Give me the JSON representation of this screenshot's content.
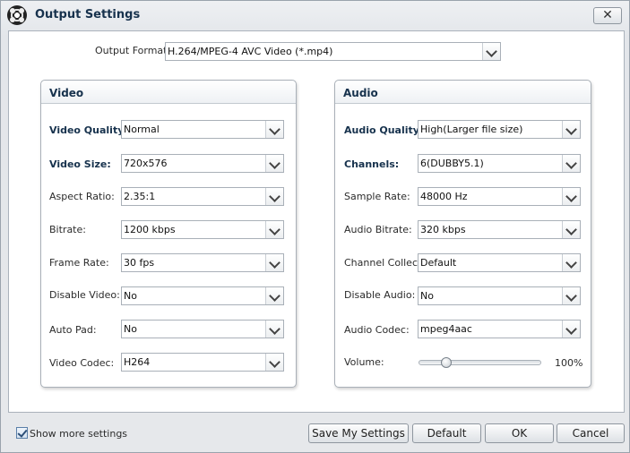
{
  "window": {
    "title": "Output Settings",
    "close_glyph": "✕"
  },
  "output": {
    "label": "Output Format:",
    "value": "H.264/MPEG-4 AVC Video (*.mp4)"
  },
  "video": {
    "header": "Video",
    "rows": [
      {
        "label": "Video Quality:",
        "value": "Normal",
        "bold": true
      },
      {
        "label": "Video Size:",
        "value": "720x576",
        "bold": true
      },
      {
        "label": "Aspect Ratio:",
        "value": "2.35:1",
        "bold": false
      },
      {
        "label": "Bitrate:",
        "value": "1200 kbps",
        "bold": false
      },
      {
        "label": "Frame Rate:",
        "value": "30 fps",
        "bold": false
      },
      {
        "label": "Disable Video:",
        "value": "No",
        "bold": false
      },
      {
        "label": "Auto Pad:",
        "value": "No",
        "bold": false
      },
      {
        "label": "Video Codec:",
        "value": "H264",
        "bold": false
      }
    ]
  },
  "audio": {
    "header": "Audio",
    "rows": [
      {
        "label": "Audio Quality:",
        "value": "High(Larger file size)",
        "bold": true
      },
      {
        "label": "Channels:",
        "value": "6(DUBBY5.1)",
        "bold": true
      },
      {
        "label": "Sample Rate:",
        "value": "48000 Hz",
        "bold": false
      },
      {
        "label": "Audio Bitrate:",
        "value": "320 kbps",
        "bold": false
      },
      {
        "label": "Channel Collect:",
        "value": "Default",
        "bold": false
      },
      {
        "label": "Disable Audio:",
        "value": "No",
        "bold": false
      },
      {
        "label": "Audio Codec:",
        "value": "mpeg4aac",
        "bold": false
      }
    ],
    "volume": {
      "label": "Volume:",
      "value_text": "100%",
      "level": 0.2
    }
  },
  "footer": {
    "show_more_label": "Show more settings",
    "show_more_checked": true,
    "buttons": {
      "save": "Save My Settings",
      "default": "Default",
      "ok": "OK",
      "cancel": "Cancel"
    }
  },
  "icons": {
    "app": "film-reel-icon",
    "close": "close-icon",
    "dropdown": "chevron-down-icon",
    "check": "checkmark-icon"
  },
  "colors": {
    "title_text": "#17324d",
    "window_bg": "#e6e8eb",
    "border": "#a9b0b8"
  }
}
